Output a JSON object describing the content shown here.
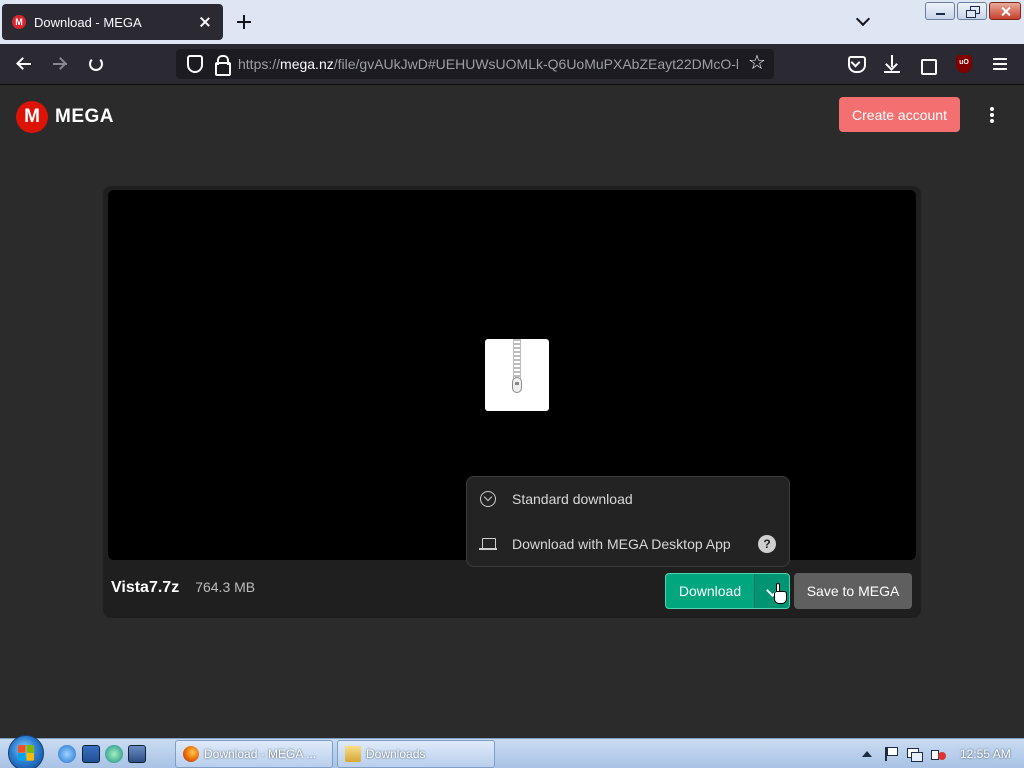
{
  "browser": {
    "tab": {
      "title": "Download - MEGA",
      "favicon_letter": "M"
    },
    "address": {
      "scheme": "https://",
      "host": "mega.nz",
      "path": "/file/gvAUkJwD#UEHUWsUOMLk-Q6UoMuPXAbZEayt22DMcO-h"
    },
    "extension_badge": "uO"
  },
  "header": {
    "logo_letter": "M",
    "logo_text": "MEGA",
    "create_account_label": "Create account"
  },
  "file": {
    "name": "Vista7.7z",
    "size": "764.3 MB",
    "icon": "zip-archive-icon"
  },
  "actions": {
    "download_label": "Download",
    "save_label": "Save to MEGA"
  },
  "dropdown": {
    "items": [
      {
        "label": "Standard download",
        "icon": "download-circle-icon"
      },
      {
        "label": "Download with MEGA Desktop App",
        "icon": "laptop-icon",
        "help_glyph": "?"
      }
    ]
  },
  "taskbar": {
    "buttons": [
      {
        "label": "Download - MEGA ..."
      },
      {
        "label": "Downloads"
      }
    ],
    "clock": "12:55 AM"
  },
  "colors": {
    "mega_red": "#dd1405",
    "create_account": "#f46f6f",
    "download_green": "#00a77e",
    "page_bg": "#2b2b2b"
  }
}
